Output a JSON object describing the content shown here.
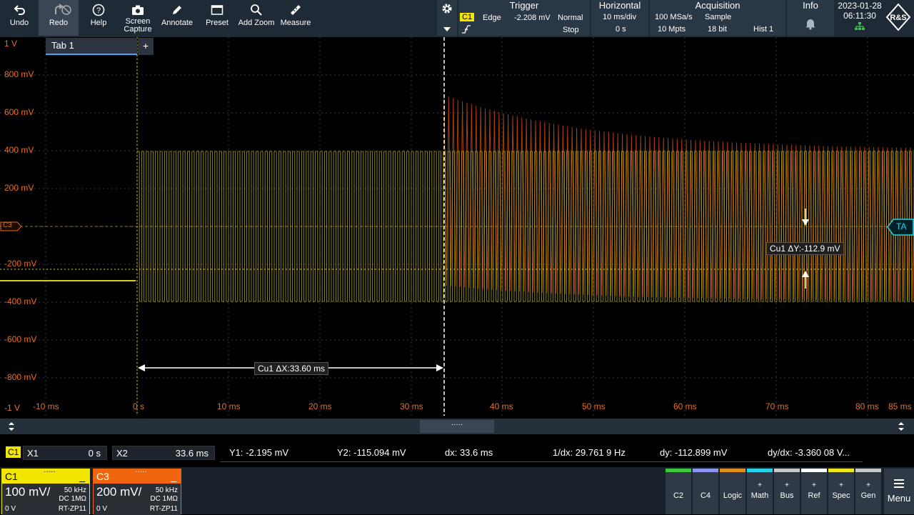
{
  "toolbar": {
    "undo": "Undo",
    "redo": "Redo",
    "help": "Help",
    "screen_capture_1": "Screen",
    "screen_capture_2": "Capture",
    "annotate": "Annotate",
    "preset": "Preset",
    "add_zoom": "Add Zoom",
    "measure": "Measure"
  },
  "trigger": {
    "title": "Trigger",
    "source": "C1",
    "type": "Edge",
    "level": "-2.208 mV",
    "mode": "Normal",
    "state": "Stop"
  },
  "horizontal": {
    "title": "Horizontal",
    "scale": "10 ms/div",
    "position": "0 s"
  },
  "acquisition": {
    "title": "Acquisition",
    "rate": "100 MSa/s",
    "mode": "Sample",
    "points": "10 Mpts",
    "resolution": "18 bit",
    "history": "Hist 1"
  },
  "info": {
    "title": "Info"
  },
  "datetime": {
    "date": "2023-01-28",
    "time": "06:11:30"
  },
  "tab": {
    "label": "Tab 1",
    "add": "+"
  },
  "y_axis_labels": [
    "1 V",
    "800 mV",
    "600 mV",
    "400 mV",
    "200 mV",
    "-200 mV",
    "-400 mV",
    "-600 mV",
    "-800 mV",
    "-1 V"
  ],
  "x_axis_labels": [
    "-10 ms",
    "0 s",
    "10 ms",
    "20 ms",
    "30 ms",
    "40 ms",
    "50 ms",
    "60 ms",
    "70 ms",
    "80 ms",
    "85 ms"
  ],
  "markers": {
    "c3": "C3",
    "ta": "TA"
  },
  "cursor_dx_label": "Cu1 ΔX:33.60 ms",
  "cursor_dy_label": "Cu1 ΔY:-112.9 mV",
  "cursor_readout": {
    "source": "C1",
    "x1_label": "X1",
    "x1_value": "0 s",
    "x2_label": "X2",
    "x2_value": "33.6 ms",
    "y1": "Y1:  -2.195 mV",
    "y2": "Y2:  -115.094 mV",
    "dx": "dx:  33.6 ms",
    "inv_dx": "1/dx:  29.761 9 Hz",
    "dy": "dy:  -112.899 mV",
    "dydx": "dy/dx:  -3.360 08 V..."
  },
  "channels": [
    {
      "name": "C1",
      "scale": "100 mV/",
      "bw": "50 kHz",
      "coupling": "DC 1MΩ",
      "offset": "0 V",
      "probe": "RT-ZP11",
      "color": "#f2e600"
    },
    {
      "name": "C3",
      "scale": "200 mV/",
      "bw": "50 kHz",
      "coupling": "DC 1MΩ",
      "offset": "0 V",
      "probe": "RT-ZP11",
      "color": "#f0660f"
    }
  ],
  "bottom_buttons": [
    {
      "label": "C2",
      "color": "#3cc83c"
    },
    {
      "label": "C4",
      "color": "#8c96f0"
    },
    {
      "label": "Logic",
      "color": "#e08c1e"
    },
    {
      "label": "Math",
      "color": "#28d2e6"
    },
    {
      "label": "Bus",
      "color": "#c8c8c8"
    },
    {
      "label": "Ref",
      "color": "#ffffff"
    },
    {
      "label": "Spec",
      "color": "#f0e61e"
    },
    {
      "label": "Gen",
      "color": "#c8c8c8"
    }
  ],
  "menu": "Menu"
}
